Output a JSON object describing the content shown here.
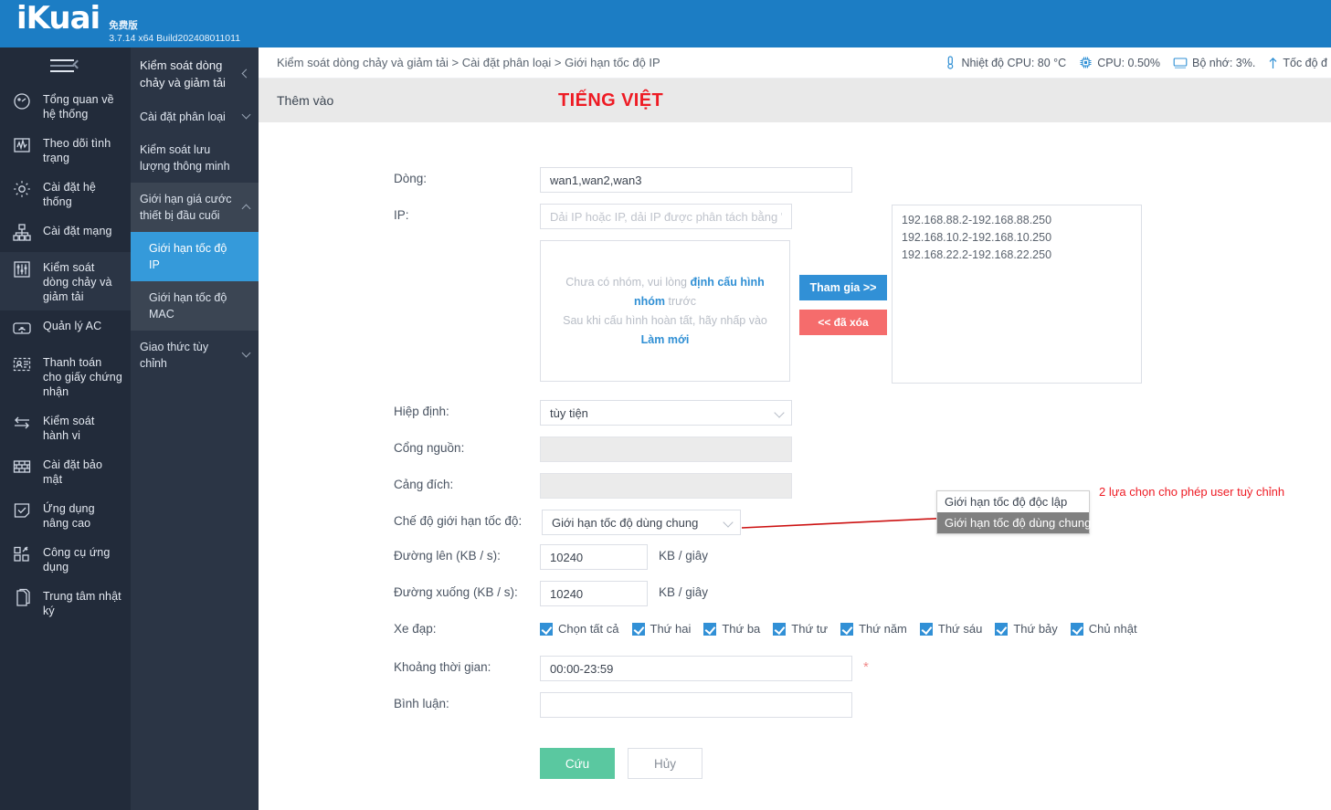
{
  "brand": {
    "logo": "iKuai",
    "edition": "免费版",
    "version": "3.7.14 x64 Build202408011011"
  },
  "rail": {
    "toggle_icon": "hamburger-collapse-icon",
    "items": [
      {
        "label": "Tổng quan về hệ thống",
        "icon": "dashboard-icon",
        "active": false
      },
      {
        "label": "Theo dõi tình trạng",
        "icon": "monitor-icon",
        "active": false
      },
      {
        "label": "Cài đặt hệ thống",
        "icon": "gear-icon",
        "active": false
      },
      {
        "label": "Cài đặt mạng",
        "icon": "network-icon",
        "active": false
      },
      {
        "label": "Kiểm soát dòng chảy và giảm tải",
        "icon": "sliders-icon",
        "active": true
      },
      {
        "label": "Quản lý AC",
        "icon": "wifi-icon",
        "active": false
      },
      {
        "label": "Thanh toán cho giấy chứng nhận",
        "icon": "id-card-icon",
        "active": false
      },
      {
        "label": "Kiểm soát hành vi",
        "icon": "exchange-arrows-icon",
        "active": false
      },
      {
        "label": "Cài đặt bảo mật",
        "icon": "firewall-brick-icon",
        "active": false
      },
      {
        "label": "Ứng dụng nâng cao",
        "icon": "check-square-icon",
        "active": false
      },
      {
        "label": "Công cụ ứng dụng",
        "icon": "app-tools-icon",
        "active": false
      },
      {
        "label": "Trung tâm nhật ký",
        "icon": "log-pages-icon",
        "active": false
      }
    ]
  },
  "submenu": {
    "header": "Kiểm soát dòng chảy và giảm tải",
    "header_caret": "chevron-left-icon",
    "items": [
      {
        "label": "Cài đặt phân loại",
        "type": "group",
        "caret": "chevron-down-icon"
      },
      {
        "label": "Kiểm soát lưu lượng thông minh",
        "type": "plain",
        "caret": ""
      },
      {
        "label": "Giới hạn giá cước thiết bị đầu cuối",
        "type": "group-open",
        "caret": "chevron-up-icon"
      },
      {
        "label": "Giới hạn tốc độ IP",
        "type": "active-child",
        "caret": ""
      },
      {
        "label": "Giới hạn tốc độ MAC",
        "type": "child",
        "caret": ""
      },
      {
        "label": "Giao thức tùy chỉnh",
        "type": "group",
        "caret": "chevron-down-icon"
      }
    ]
  },
  "topbar": {
    "breadcrumb": "Kiểm soát dòng chảy và giảm tải > Cài đặt phân loại > Giới hạn tốc độ IP",
    "stats": [
      {
        "icon": "thermometer-icon",
        "text": "Nhiệt độ CPU: 80 °C"
      },
      {
        "icon": "cpu-chip-icon",
        "text": "CPU: 0.50%"
      },
      {
        "icon": "memory-monitor-icon",
        "text": "Bộ nhớ: 3%."
      },
      {
        "icon": "arrow-up-icon",
        "text": "Tốc độ đ"
      }
    ]
  },
  "pagehead": {
    "tab_label": "Thêm vào",
    "badge": "TIẾNG VIỆT",
    "badge_color": "#ee1b24"
  },
  "form": {
    "line": {
      "label": "Dòng:",
      "value": "wan1,wan2,wan3"
    },
    "ip": {
      "label": "IP:",
      "placeholder": "Dải IP hoặc IP, dải IP được phân tách bằng \"-\"."
    },
    "group_box": {
      "line1_pre": "Chưa có nhóm, vui lòng ",
      "line1_link": "định cấu hình nhóm",
      "line1_post": " trước",
      "line2_pre": "Sau khi cấu hình hoàn tất, hãy nhấp vào ",
      "line2_link": "Làm mới"
    },
    "join_button": "Tham gia >>",
    "remove_button": "<< đã xóa",
    "selected_ips": [
      "192.168.88.2-192.168.88.250",
      "192.168.10.2-192.168.10.250",
      "192.168.22.2-192.168.22.250"
    ],
    "protocol": {
      "label": "Hiệp định:",
      "value": "tùy tiện"
    },
    "src_port": {
      "label": "Cổng nguồn:",
      "value": ""
    },
    "dst_port": {
      "label": "Cảng đích:",
      "value": ""
    },
    "limit_mode": {
      "label": "Chế độ giới hạn tốc độ:",
      "value": "Giới hạn tốc độ  dùng chung"
    },
    "uplink": {
      "label": "Đường lên (KB / s):",
      "value": "10240",
      "unit": "KB / giây"
    },
    "downlink": {
      "label": "Đường xuống (KB / s):",
      "value": "10240",
      "unit": "KB / giây"
    },
    "weekdays": {
      "label": "Xe đạp:",
      "items": [
        {
          "label": "Chọn tất cả",
          "checked": true
        },
        {
          "label": "Thứ hai",
          "checked": true
        },
        {
          "label": "Thứ ba",
          "checked": true
        },
        {
          "label": "Thứ tư",
          "checked": true
        },
        {
          "label": "Thứ năm",
          "checked": true
        },
        {
          "label": "Thứ sáu",
          "checked": true
        },
        {
          "label": "Thứ bảy",
          "checked": true
        },
        {
          "label": "Chủ nhật",
          "checked": true
        }
      ]
    },
    "time_range": {
      "label": "Khoảng thời gian:",
      "value": "00:00-23:59",
      "required_mark": "*"
    },
    "comment": {
      "label": "Bình luận:",
      "value": ""
    },
    "save_button": "Cứu",
    "cancel_button": "Hủy"
  },
  "annotation": {
    "options": [
      {
        "label": "Giới hạn tốc độ độc lập",
        "highlighted": false
      },
      {
        "label": "Giới hạn tốc độ dùng chung",
        "highlighted": true
      }
    ],
    "note": "2 lựa chọn cho phép user tuỳ chỉnh",
    "note_color": "#ee1b24"
  }
}
